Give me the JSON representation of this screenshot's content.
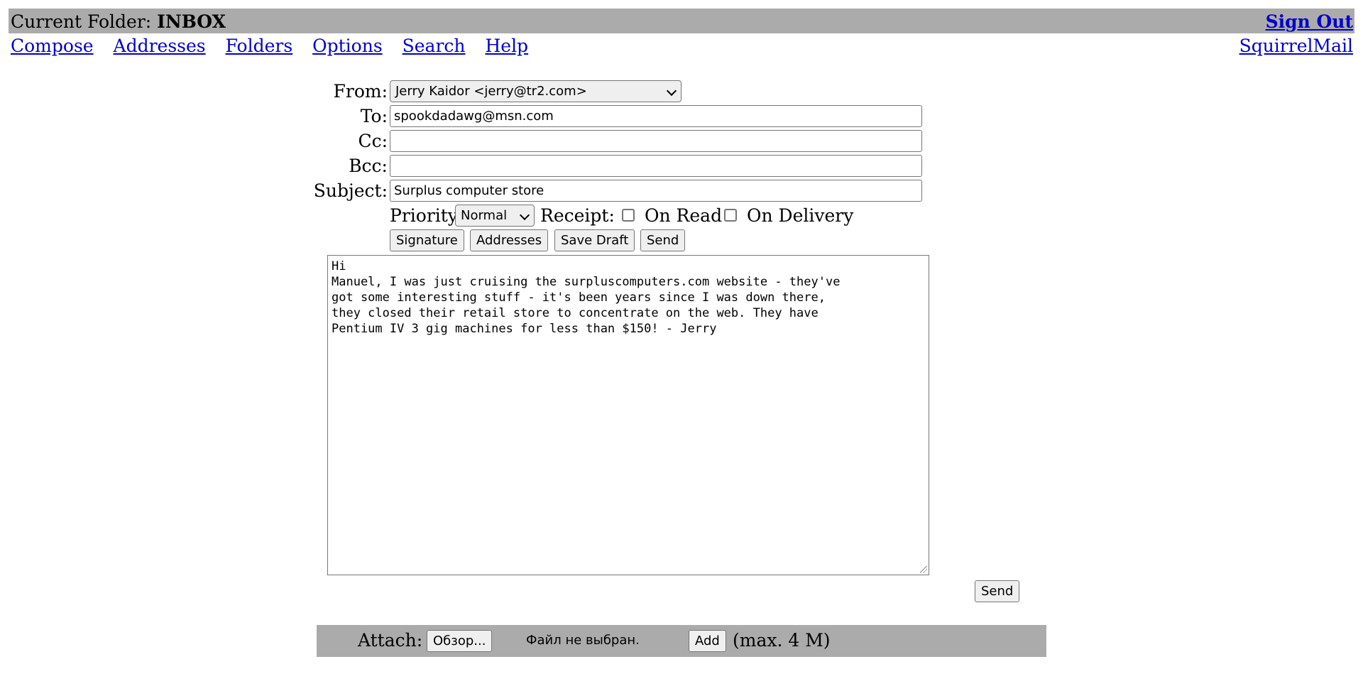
{
  "header": {
    "folder_label": "Current Folder:",
    "folder_name": "INBOX",
    "sign_out": "Sign Out"
  },
  "nav": {
    "items": [
      "Compose",
      "Addresses",
      "Folders",
      "Options",
      "Search",
      "Help"
    ],
    "brand_link": "SquirrelMail"
  },
  "compose": {
    "from_label": "From:",
    "from_value": "Jerry Kaidor <jerry@tr2.com>",
    "to_label": "To:",
    "to_value": "spookdadawg@msn.com",
    "cc_label": "Cc:",
    "cc_value": "",
    "bcc_label": "Bcc:",
    "bcc_value": "",
    "subject_label": "Subject:",
    "subject_value": "Surplus computer store",
    "priority_label": "Priority",
    "priority_value": "Normal",
    "receipt_label": "Receipt:",
    "on_read_label": "On Read",
    "on_delivery_label": "On Delivery",
    "buttons": {
      "signature": "Signature",
      "addresses": "Addresses",
      "save_draft": "Save Draft",
      "send": "Send"
    },
    "body": "Hi\nManuel, I was just cruising the surpluscomputers.com website - they've\ngot some interesting stuff - it's been years since I was down there,\nthey closed their retail store to concentrate on the web. They have\nPentium IV 3 gig machines for less than $150! - Jerry",
    "send_bottom": "Send"
  },
  "attach": {
    "label": "Attach:",
    "browse_button": "Обзор...",
    "no_file": "Файл не выбран.",
    "add_button": "Add",
    "max_note": "(max. 4 M)"
  },
  "colors": {
    "bar_gray": "#ababab",
    "link_blue": "#0000cc"
  }
}
